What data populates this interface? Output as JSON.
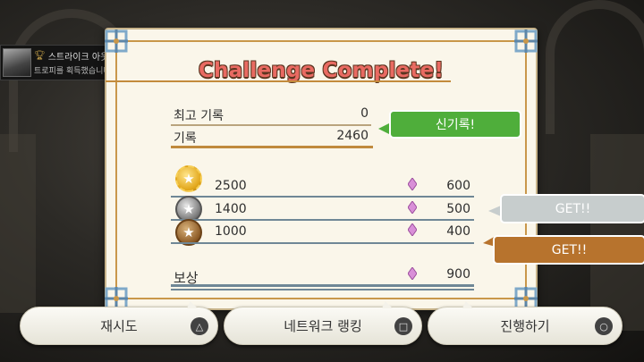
{
  "trophy": {
    "title": "스트라이크 아웃",
    "message": "트로피를 획득했습니다!",
    "ps_icon": "playstation-icon"
  },
  "panel": {
    "title": "Challenge Complete!",
    "best_record_label": "최고 기록",
    "best_record_value": "0",
    "record_label": "기록",
    "record_value": "2460",
    "new_record_badge": "신기록!",
    "medals": [
      {
        "icon": "gold-medal-icon",
        "threshold": "2500",
        "reward": "600"
      },
      {
        "icon": "silver-medal-icon",
        "threshold": "1400",
        "reward": "500"
      },
      {
        "icon": "bronze-medal-icon",
        "threshold": "1000",
        "reward": "400"
      }
    ],
    "get_badges": [
      "GET!!",
      "GET!!"
    ],
    "reward_label": "보상",
    "reward_value": "900"
  },
  "buttons": {
    "retry": {
      "label": "재시도",
      "symbol": "triangle-icon"
    },
    "ranking": {
      "label": "네트워크 랭킹",
      "symbol": "square-icon"
    },
    "continue": {
      "label": "진행하기",
      "symbol": "circle-icon"
    }
  },
  "colors": {
    "title_red": "#e96a62",
    "new_record_green": "#4fae3b",
    "get_gray": "#c7cdcd",
    "get_brown": "#b7732d",
    "panel_bg": "#faf6ea"
  }
}
